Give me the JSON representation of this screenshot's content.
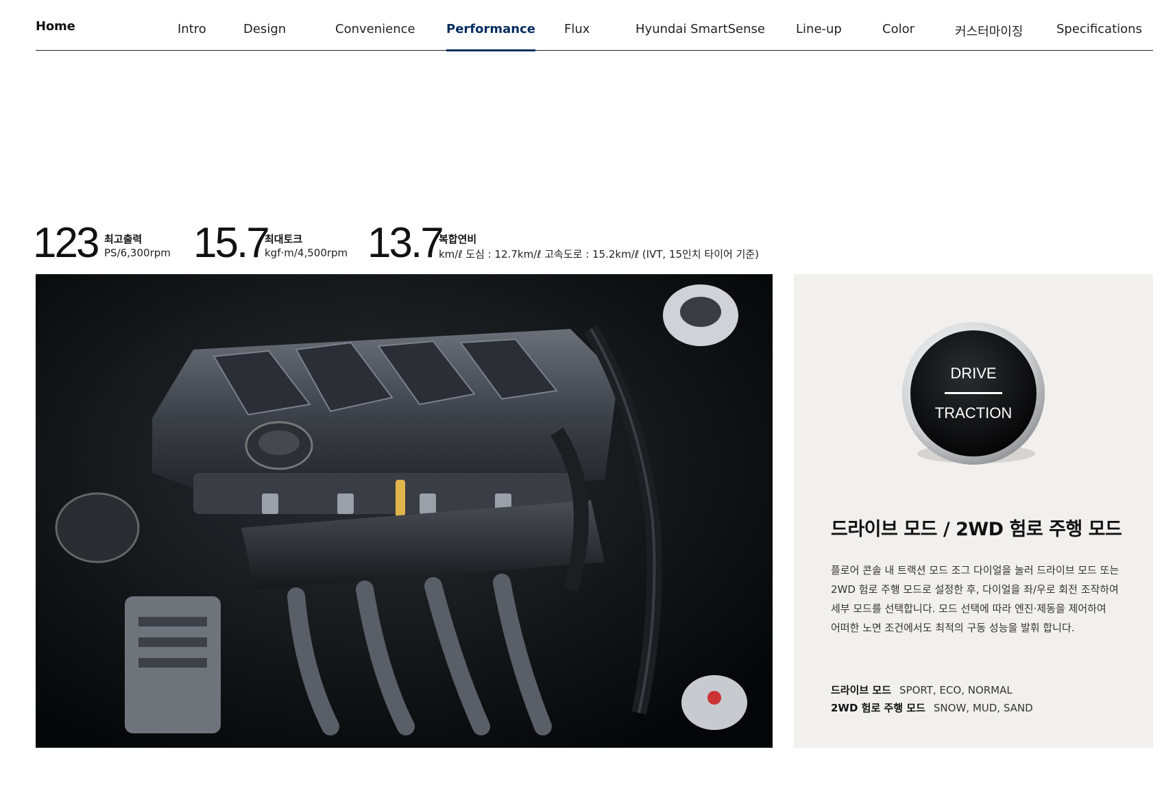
{
  "nav": {
    "home": "Home",
    "items": [
      {
        "label": "Intro"
      },
      {
        "label": "Design"
      },
      {
        "label": "Convenience"
      },
      {
        "label": "Performance",
        "active": true
      },
      {
        "label": "Flux"
      },
      {
        "label": "Hyundai SmartSense"
      },
      {
        "label": "Line-up"
      },
      {
        "label": "Color"
      },
      {
        "label": "커스터마이징"
      },
      {
        "label": "Specifications"
      }
    ],
    "active_color": "#002c5f"
  },
  "specs": [
    {
      "value": "123",
      "label": "최고출력",
      "unit": "PS/6,300rpm"
    },
    {
      "value": "15.7",
      "label": "최대토크",
      "unit": "kgf·m/4,500rpm"
    },
    {
      "value": "13.7",
      "label": "복합연비",
      "unit": "km/ℓ  도심 : 12.7km/ℓ 고속도로 : 15.2km/ℓ (IVT, 15인치 타이어 기준)"
    }
  ],
  "engine_image": {
    "icon": "engine-photo"
  },
  "panel": {
    "knob": {
      "top_text": "DRIVE",
      "bottom_text": "TRACTION"
    },
    "title": "드라이브 모드 / 2WD 험로 주행 모드",
    "body": "플로어 콘솔 내 트랙션 모드 조그 다이얼을 눌러 드라이브 모드 또는 2WD 험로 주행 모드로 설정한 후, 다이얼을 좌/우로 회전 조작하여 세부 모드를 선택합니다. 모드 선택에 따라 엔진·제동을 제어하여 어떠한 노면 조건에서도 최적의 구동 성능을 발휘 합니다.",
    "modes": [
      {
        "key": "드라이브 모드",
        "value": "SPORT, ECO, NORMAL"
      },
      {
        "key": "2WD 험로 주행 모드",
        "value": "SNOW, MUD, SAND"
      }
    ],
    "background": "#f1f0ee"
  }
}
